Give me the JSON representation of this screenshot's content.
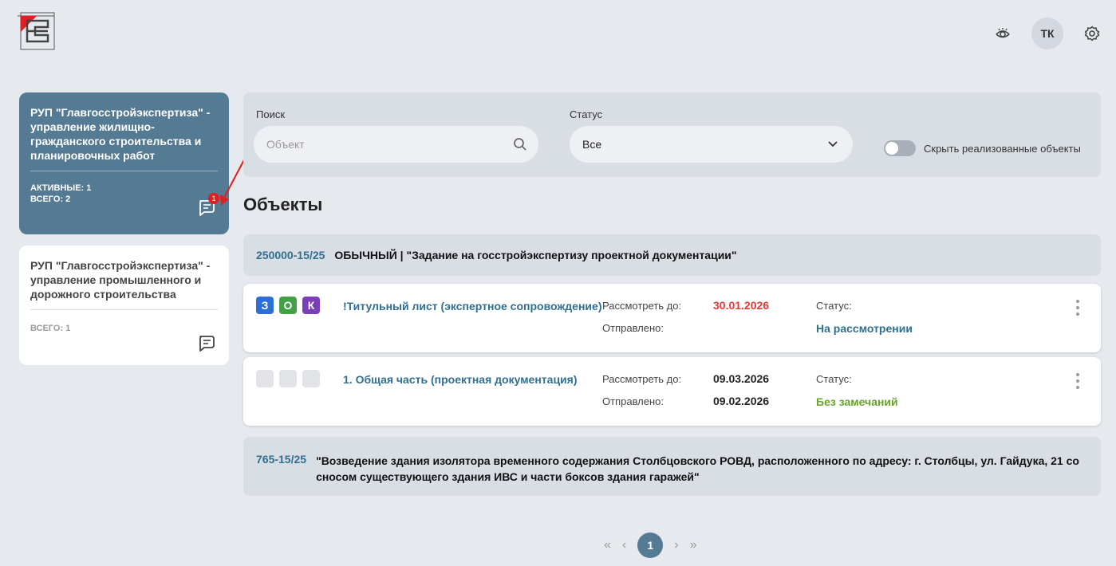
{
  "header": {
    "avatar_initials": "ТК",
    "icons": [
      "eye-icon",
      "gear-icon"
    ],
    "logo_colors": {
      "red": "#e02020",
      "frame": "#555555"
    }
  },
  "sidebar": {
    "orgs": [
      {
        "name": "РУП \"Главгосстройэкспертиза\" - управление жилищно-гражданского строительства и планировочных работ",
        "active_label": "АКТИВНЫЕ: 1",
        "total_label": "ВСЕГО: 2",
        "badge": "1"
      },
      {
        "name": "РУП \"Главгосстройэкспертиза\" - управление промышленного и дорожного строительства",
        "total_label": "ВСЕГО: 1"
      }
    ]
  },
  "filters": {
    "search_label": "Поиск",
    "search_placeholder": "Объект",
    "status_label": "Статус",
    "status_value": "Все",
    "toggle_label": "Скрыть реализованные объекты"
  },
  "section_title": "Объекты",
  "objects": [
    {
      "number": "250000-15/25",
      "title": "ОБЫЧНЫЙ | \"Задание на госстройэкспертизу проектной документации\"",
      "documents": [
        {
          "tags": [
            "З",
            "О",
            "К"
          ],
          "name": "!Титульный лист (экспертное сопровождение)",
          "review_label": "Рассмотреть до:",
          "review_date": "30.01.2026",
          "sent_label": "Отправлено:",
          "sent_date": "",
          "status_label": "Статус:",
          "status_value": "На рассмотрении"
        },
        {
          "tags": [
            "",
            "",
            ""
          ],
          "name": "1. Общая часть (проектная документация)",
          "review_label": "Рассмотреть до:",
          "review_date": "09.03.2026",
          "sent_label": "Отправлено:",
          "sent_date": "09.02.2026",
          "status_label": "Статус:",
          "status_value": "Без замечаний"
        }
      ]
    },
    {
      "number": "765-15/25",
      "title": "\"Возведение здания изолятора временного содержания Столбцовского РОВД, расположенного по адресу: г. Столбцы, ул. Гайдука, 21 со сносом существующего здания ИВС и части боксов здания гаражей\""
    }
  ],
  "pagination": {
    "first": "«",
    "prev": "‹",
    "current": "1",
    "next": "›",
    "last": "»"
  },
  "colors": {
    "active_card": "#557a93",
    "accent_teal": "#2f6f8f",
    "tag_z": "#2d6fd4",
    "tag_o": "#43a047",
    "tag_k": "#7b3fb6",
    "overdue_red": "#e53935",
    "status_ok_green": "#6aa32c",
    "page_active": "#557a93"
  }
}
